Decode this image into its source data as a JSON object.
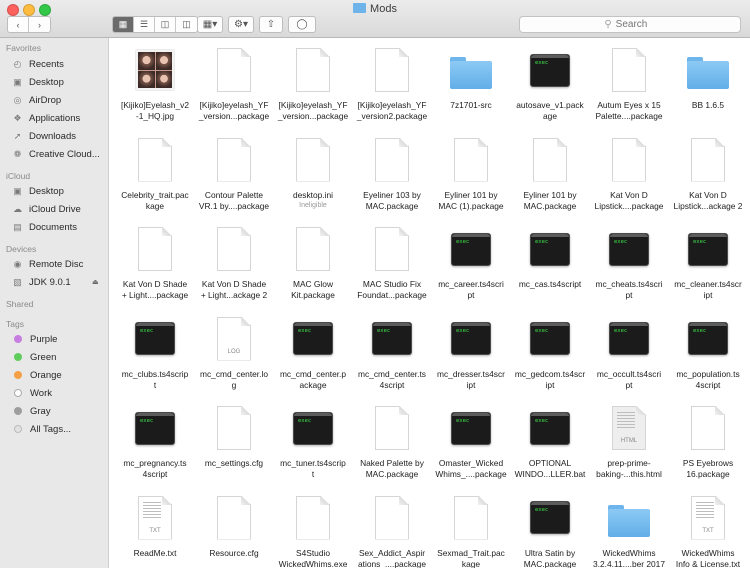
{
  "window": {
    "title": "Mods",
    "colors": {
      "close": "#fc615d",
      "minimize": "#fdbc40",
      "zoom": "#34c84a",
      "folder": "#6eb4ea"
    }
  },
  "toolbar": {
    "back_icon": "chevron-left-icon",
    "forward_icon": "chevron-right-icon",
    "view_icons": [
      "icon-view-icon",
      "list-view-icon",
      "column-view-icon",
      "cover-flow-icon"
    ],
    "search_placeholder": "Search"
  },
  "sidebar": {
    "favorites_title": "Favorites",
    "favorites": [
      {
        "label": "Recents",
        "icon": "clock-icon"
      },
      {
        "label": "Desktop",
        "icon": "desktop-icon"
      },
      {
        "label": "AirDrop",
        "icon": "airdrop-icon"
      },
      {
        "label": "Applications",
        "icon": "applications-icon"
      },
      {
        "label": "Downloads",
        "icon": "download-icon"
      },
      {
        "label": "Creative Cloud...",
        "icon": "creative-cloud-icon"
      }
    ],
    "icloud_title": "iCloud",
    "icloud": [
      {
        "label": "Desktop",
        "icon": "desktop-icon"
      },
      {
        "label": "iCloud Drive",
        "icon": "cloud-icon"
      },
      {
        "label": "Documents",
        "icon": "document-icon"
      }
    ],
    "devices_title": "Devices",
    "devices": [
      {
        "label": "Remote Disc",
        "icon": "disc-icon"
      },
      {
        "label": "JDK 9.0.1",
        "icon": "drive-icon"
      }
    ],
    "shared_title": "Shared",
    "tags_title": "Tags",
    "tags": [
      {
        "label": "Purple",
        "color": "#c77ee0"
      },
      {
        "label": "Green",
        "color": "#5fcd5b"
      },
      {
        "label": "Orange",
        "color": "#f3a046"
      },
      {
        "label": "Work",
        "color": "#bdbdbd"
      },
      {
        "label": "Gray",
        "color": "#9e9e9e"
      },
      {
        "label": "All Tags...",
        "color": "#d6d6d6"
      }
    ]
  },
  "files": [
    {
      "name": "[Kijiko]Eyelash_v2\n-1_HQ.jpg",
      "kind": "photo"
    },
    {
      "name": "[Kijiko]eyelash_YF\n_version...package",
      "kind": "doc"
    },
    {
      "name": "[Kijiko]eyelash_YF\n_version...package",
      "kind": "doc"
    },
    {
      "name": "[Kijiko]eyelash_YF\n_version2.package",
      "kind": "doc"
    },
    {
      "name": "7z1701-src",
      "kind": "folder"
    },
    {
      "name": "autosave_v1.pack\nage",
      "kind": "exec"
    },
    {
      "name": "Autum Eyes x 15\nPalette....package",
      "kind": "doc"
    },
    {
      "name": "BB 1.6.5",
      "kind": "folder"
    },
    {
      "name": "Celebrity_trait.pac\nkage",
      "kind": "doc"
    },
    {
      "name": "Contour Palette\nVR.1 by....package",
      "kind": "doc"
    },
    {
      "name": "desktop.ini",
      "kind": "doc",
      "sub": "Ineligible"
    },
    {
      "name": "Eyeliner 103 by\nMAC.package",
      "kind": "doc"
    },
    {
      "name": "Eyliner 101 by\nMAC (1).package",
      "kind": "doc"
    },
    {
      "name": "Eyliner 101 by\nMAC.package",
      "kind": "doc"
    },
    {
      "name": "Kat Von D\nLipstick....package",
      "kind": "doc"
    },
    {
      "name": "Kat Von D\nLipstick...ackage 2",
      "kind": "doc"
    },
    {
      "name": "Kat Von D Shade\n+ Light....package",
      "kind": "doc"
    },
    {
      "name": "Kat Von D Shade\n+ Light...ackage 2",
      "kind": "doc"
    },
    {
      "name": "MAC Glow\nKit.package",
      "kind": "doc"
    },
    {
      "name": "MAC Studio Fix\nFoundat...package",
      "kind": "doc"
    },
    {
      "name": "mc_career.ts4scri\npt",
      "kind": "exec"
    },
    {
      "name": "mc_cas.ts4script",
      "kind": "exec"
    },
    {
      "name": "mc_cheats.ts4scri\npt",
      "kind": "exec"
    },
    {
      "name": "mc_cleaner.ts4scr\nipt",
      "kind": "exec"
    },
    {
      "name": "mc_clubs.ts4scrip\nt",
      "kind": "exec"
    },
    {
      "name": "mc_cmd_center.lo\ng",
      "kind": "doc",
      "tag": "LOG"
    },
    {
      "name": "mc_cmd_center.p\nackage",
      "kind": "exec"
    },
    {
      "name": "mc_cmd_center.ts\n4script",
      "kind": "exec"
    },
    {
      "name": "mc_dresser.ts4scr\nipt",
      "kind": "exec"
    },
    {
      "name": "mc_gedcom.ts4scr\nipt",
      "kind": "exec"
    },
    {
      "name": "mc_occult.ts4scri\npt",
      "kind": "exec"
    },
    {
      "name": "mc_population.ts\n4script",
      "kind": "exec"
    },
    {
      "name": "mc_pregnancy.ts\n4script",
      "kind": "exec"
    },
    {
      "name": "mc_settings.cfg",
      "kind": "doc"
    },
    {
      "name": "mc_tuner.ts4scrip\nt",
      "kind": "exec"
    },
    {
      "name": "Naked Palette by\nMAC.package",
      "kind": "doc"
    },
    {
      "name": "Omaster_Wicked\nWhims_....package",
      "kind": "exec"
    },
    {
      "name": "OPTIONAL\nWINDO...LLER.bat",
      "kind": "exec"
    },
    {
      "name": "prep-prime-\nbaking-...this.html",
      "kind": "html",
      "tag": "HTML"
    },
    {
      "name": "PS Eyebrows\n16.package",
      "kind": "doc"
    },
    {
      "name": "ReadMe.txt",
      "kind": "txt",
      "tag": "TXT"
    },
    {
      "name": "Resource.cfg",
      "kind": "doc"
    },
    {
      "name": "S4Studio\nWickedWhims.exe",
      "kind": "doc"
    },
    {
      "name": "Sex_Addict_Aspir\nations_....package",
      "kind": "doc"
    },
    {
      "name": "Sexmad_Trait.pac\nkage",
      "kind": "doc"
    },
    {
      "name": "Ultra Satin by\nMAC.package",
      "kind": "exec"
    },
    {
      "name": "WickedWhims\n3.2.4.11....ber 2017",
      "kind": "folder"
    },
    {
      "name": "WickedWhims\nInfo & License.txt",
      "kind": "txt",
      "tag": "TXT"
    }
  ],
  "exec_label": "exec"
}
